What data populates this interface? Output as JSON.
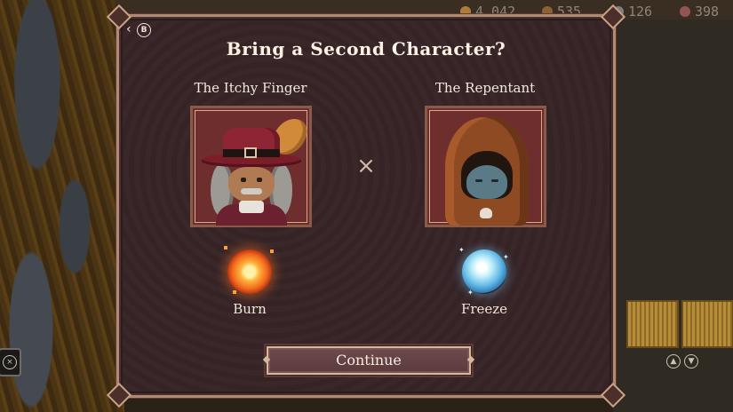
{
  "hud": {
    "resources": [
      {
        "icon": "coin-icon",
        "value": "4,042",
        "color": "#c48a3a"
      },
      {
        "icon": "wood-icon",
        "value": "535",
        "color": "#9a6b3a"
      },
      {
        "icon": "stone-icon",
        "value": "126",
        "color": "#8b8f96"
      },
      {
        "icon": "meat-icon",
        "value": "398",
        "color": "#a35c5c"
      }
    ]
  },
  "dialog": {
    "back_key": "B",
    "title": "Bring a Second Character?",
    "characters": [
      {
        "name": "The Itchy Finger",
        "ability": "Burn",
        "ability_icon": "fire-orb-icon",
        "accent": "#f16a1d"
      },
      {
        "name": "The Repentant",
        "ability": "Freeze",
        "ability_icon": "ice-orb-icon",
        "accent": "#63b9e6"
      }
    ],
    "separator_icon": "close-icon",
    "continue_label": "Continue"
  }
}
